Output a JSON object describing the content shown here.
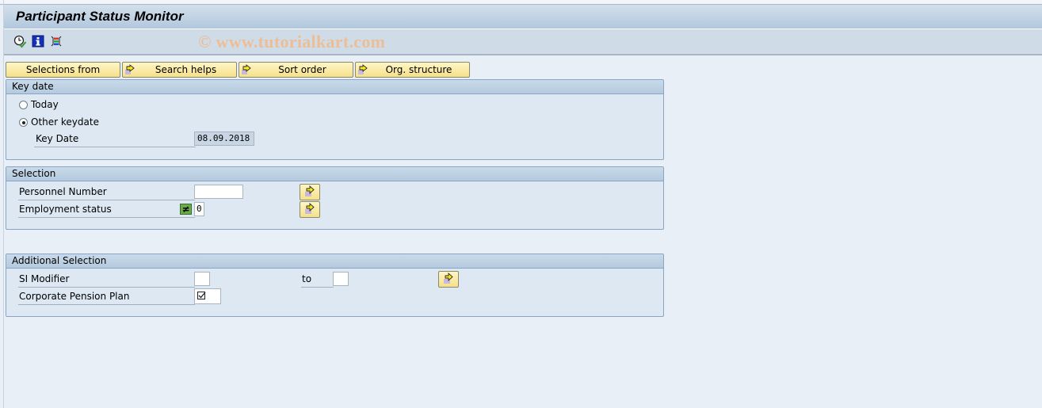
{
  "window": {
    "title": "Participant Status Monitor",
    "watermark": "© www.tutorialkart.com"
  },
  "toolbar": {
    "icons": [
      {
        "name": "execute-clock-icon",
        "tooltip": "Execute"
      },
      {
        "name": "info-icon",
        "tooltip": "Program documentation"
      },
      {
        "name": "get-variant-icon",
        "tooltip": "Selection screen variants"
      }
    ]
  },
  "tab_buttons": [
    {
      "label": "Selections from",
      "has_icon": false
    },
    {
      "label": "Search helps",
      "has_icon": true
    },
    {
      "label": "Sort order",
      "has_icon": true
    },
    {
      "label": "Org. structure",
      "has_icon": true
    }
  ],
  "key_date_group": {
    "title": "Key date",
    "radio_today": {
      "label": "Today",
      "selected": false
    },
    "radio_other": {
      "label": "Other keydate",
      "selected": true
    },
    "key_date": {
      "label": "Key Date",
      "value": "08.09.2018"
    }
  },
  "selection_group": {
    "title": "Selection",
    "personnel_number": {
      "label": "Personnel Number",
      "value": ""
    },
    "employment_status": {
      "label": "Employment status",
      "operator": "≠",
      "value": "0"
    }
  },
  "additional_group": {
    "title": "Additional Selection",
    "si_modifier": {
      "label": "SI Modifier",
      "from": "",
      "to_label": "to",
      "to": ""
    },
    "corporate_pension_plan": {
      "label": "Corporate Pension Plan",
      "checked": true
    }
  },
  "colors": {
    "button_yellow": "#f5e08a",
    "group_border": "#8aa5c3",
    "background": "#e8eff7",
    "operator_green": "#6aaa4a"
  }
}
